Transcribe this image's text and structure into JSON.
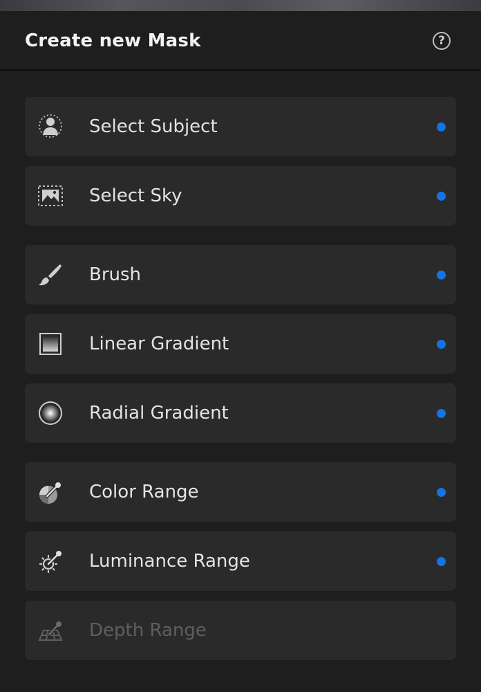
{
  "panel": {
    "title": "Create new Mask",
    "help_icon": "help-circle-icon",
    "help_glyph": "?"
  },
  "accent_color": "#1473e6",
  "items": [
    {
      "label": "Select Subject",
      "icon": "select-subject-icon",
      "enabled": true,
      "indicator": true
    },
    {
      "label": "Select Sky",
      "icon": "select-sky-icon",
      "enabled": true,
      "indicator": true
    },
    {
      "label": "Brush",
      "icon": "brush-icon",
      "enabled": true,
      "indicator": true
    },
    {
      "label": "Linear Gradient",
      "icon": "linear-gradient-icon",
      "enabled": true,
      "indicator": true
    },
    {
      "label": "Radial Gradient",
      "icon": "radial-gradient-icon",
      "enabled": true,
      "indicator": true
    },
    {
      "label": "Color Range",
      "icon": "color-range-icon",
      "enabled": true,
      "indicator": true
    },
    {
      "label": "Luminance Range",
      "icon": "luminance-range-icon",
      "enabled": true,
      "indicator": true
    },
    {
      "label": "Depth Range",
      "icon": "depth-range-icon",
      "enabled": false,
      "indicator": false
    }
  ]
}
